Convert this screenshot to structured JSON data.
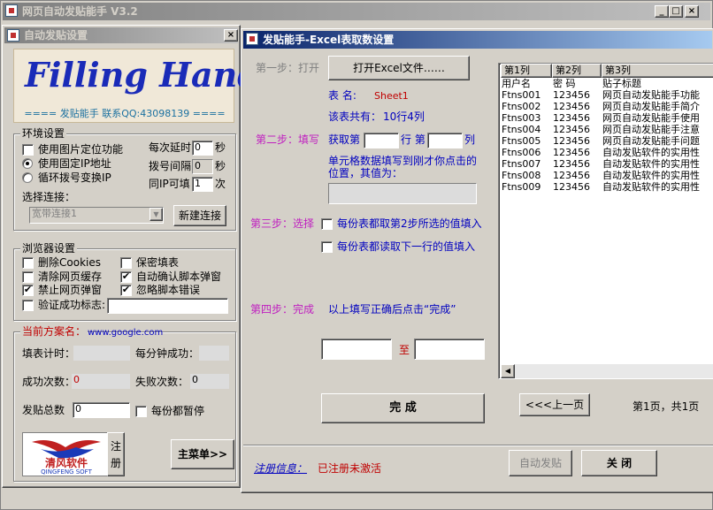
{
  "main_window": {
    "title": "网页自动发贴能手 V3.2",
    "caption_buttons": [
      "_",
      "□",
      "×"
    ]
  },
  "settings_window": {
    "title": "自动发贴设置",
    "close": "×",
    "logo_text": "Filling Hands",
    "slogan": "==== 发贴能手  联系QQ:43098139 ====",
    "env_group": {
      "label": "环境设置",
      "options": [
        {
          "label": "使用图片定位功能",
          "checked": false
        },
        {
          "label": "使用固定IP地址",
          "selected": true
        },
        {
          "label": "循环拨号变换IP",
          "selected": false
        }
      ],
      "delay_label": "每次延时",
      "delay_value": "0",
      "delay_unit": "秒",
      "dial_label": "拨号间隔",
      "dial_value": "0",
      "dial_unit": "秒",
      "ip_label": "同IP可填",
      "ip_value": "1",
      "ip_unit": "次",
      "connection_label": "选择连接：",
      "connection_value": "宽带连接1",
      "new_connection_button": "新建连接"
    },
    "browser_group": {
      "label": "浏览器设置",
      "items": [
        {
          "label": "删除Cookies",
          "checked": false
        },
        {
          "label": "保密填表",
          "checked": false
        },
        {
          "label": "清除网页缓存",
          "checked": false
        },
        {
          "label": "自动确认脚本弹窗",
          "checked": true
        },
        {
          "label": "禁止网页弹窗",
          "checked": true
        },
        {
          "label": "忽略脚本错误",
          "checked": true
        },
        {
          "label": "验证成功标志:",
          "checked": false
        }
      ]
    },
    "plan_group": {
      "label": "当前方案名：",
      "url": "www.google.com",
      "fill_timer_label": "填表计时：",
      "per_minute_label": "每分钟成功：",
      "success_label": "成功次数：",
      "success_value": "0",
      "fail_label": "失败次数：",
      "fail_value": "0",
      "total_label": "发贴总数",
      "total_value": "0",
      "pause_label": "每份都暂停",
      "company_name": "清风软件",
      "company_sub": "QINGFENG SOFT",
      "register_button": "注册",
      "main_menu_button": "主菜单>>"
    }
  },
  "excel_dialog": {
    "title": "发贴能手-Excel表取数设置",
    "step1_label": "第一步：打开",
    "open_button": "打开Excel文件……",
    "sheet_label": "表    名:",
    "sheet_value": "Sheet1",
    "total_label": "该表共有：",
    "total_value": "10行4列",
    "step2_label": "第二步：填写",
    "fetch_label": "获取第",
    "row_label": "行  第",
    "col_label": "列",
    "desc_line1": "单元格数据填写到刚才你点击的",
    "desc_line2": "位置，其值为：",
    "step3_label": "第三步：选择",
    "option1": "每份表都取第2步所选的值填入",
    "option2": "每份表都读取下一行的值填入",
    "step4_label": "第四步：完成",
    "step4_desc": "以上填写正确后点击“完成”",
    "to_label": "至",
    "finish_button": "完  成",
    "prev_button": "<<<上一页",
    "page_info": "第1页，共1页",
    "register_info_label": "注册信息：",
    "register_status": "已注册未激活",
    "auto_post_button": "自动发贴",
    "close_button": "关  闭",
    "table": {
      "headers": [
        "第1列",
        "第2列",
        "第3列"
      ],
      "rows": [
        [
          "用户名",
          "密  码",
          "贴子标题"
        ],
        [
          "Ftns001",
          "123456",
          "网页自动发贴能手功能"
        ],
        [
          "Ftns002",
          "123456",
          "网页自动发贴能手简介"
        ],
        [
          "Ftns003",
          "123456",
          "网页自动发贴能手使用"
        ],
        [
          "Ftns004",
          "123456",
          "网页自动发贴能手注意"
        ],
        [
          "Ftns005",
          "123456",
          "网页自动发贴能手问题"
        ],
        [
          "Ftns006",
          "123456",
          "自动发贴软件的实用性"
        ],
        [
          "Ftns007",
          "123456",
          "自动发贴软件的实用性"
        ],
        [
          "Ftns008",
          "123456",
          "自动发贴软件的实用性"
        ],
        [
          "Ftns009",
          "123456",
          "自动发贴软件的实用性"
        ]
      ]
    }
  },
  "colors": {
    "title_active": "#0a246a",
    "step_label": "#c020c0",
    "value_blue": "#0000c0",
    "red_text": "#c00000",
    "logo_blue": "#1a2bb8",
    "logo_panel": "#f0e8d8"
  }
}
